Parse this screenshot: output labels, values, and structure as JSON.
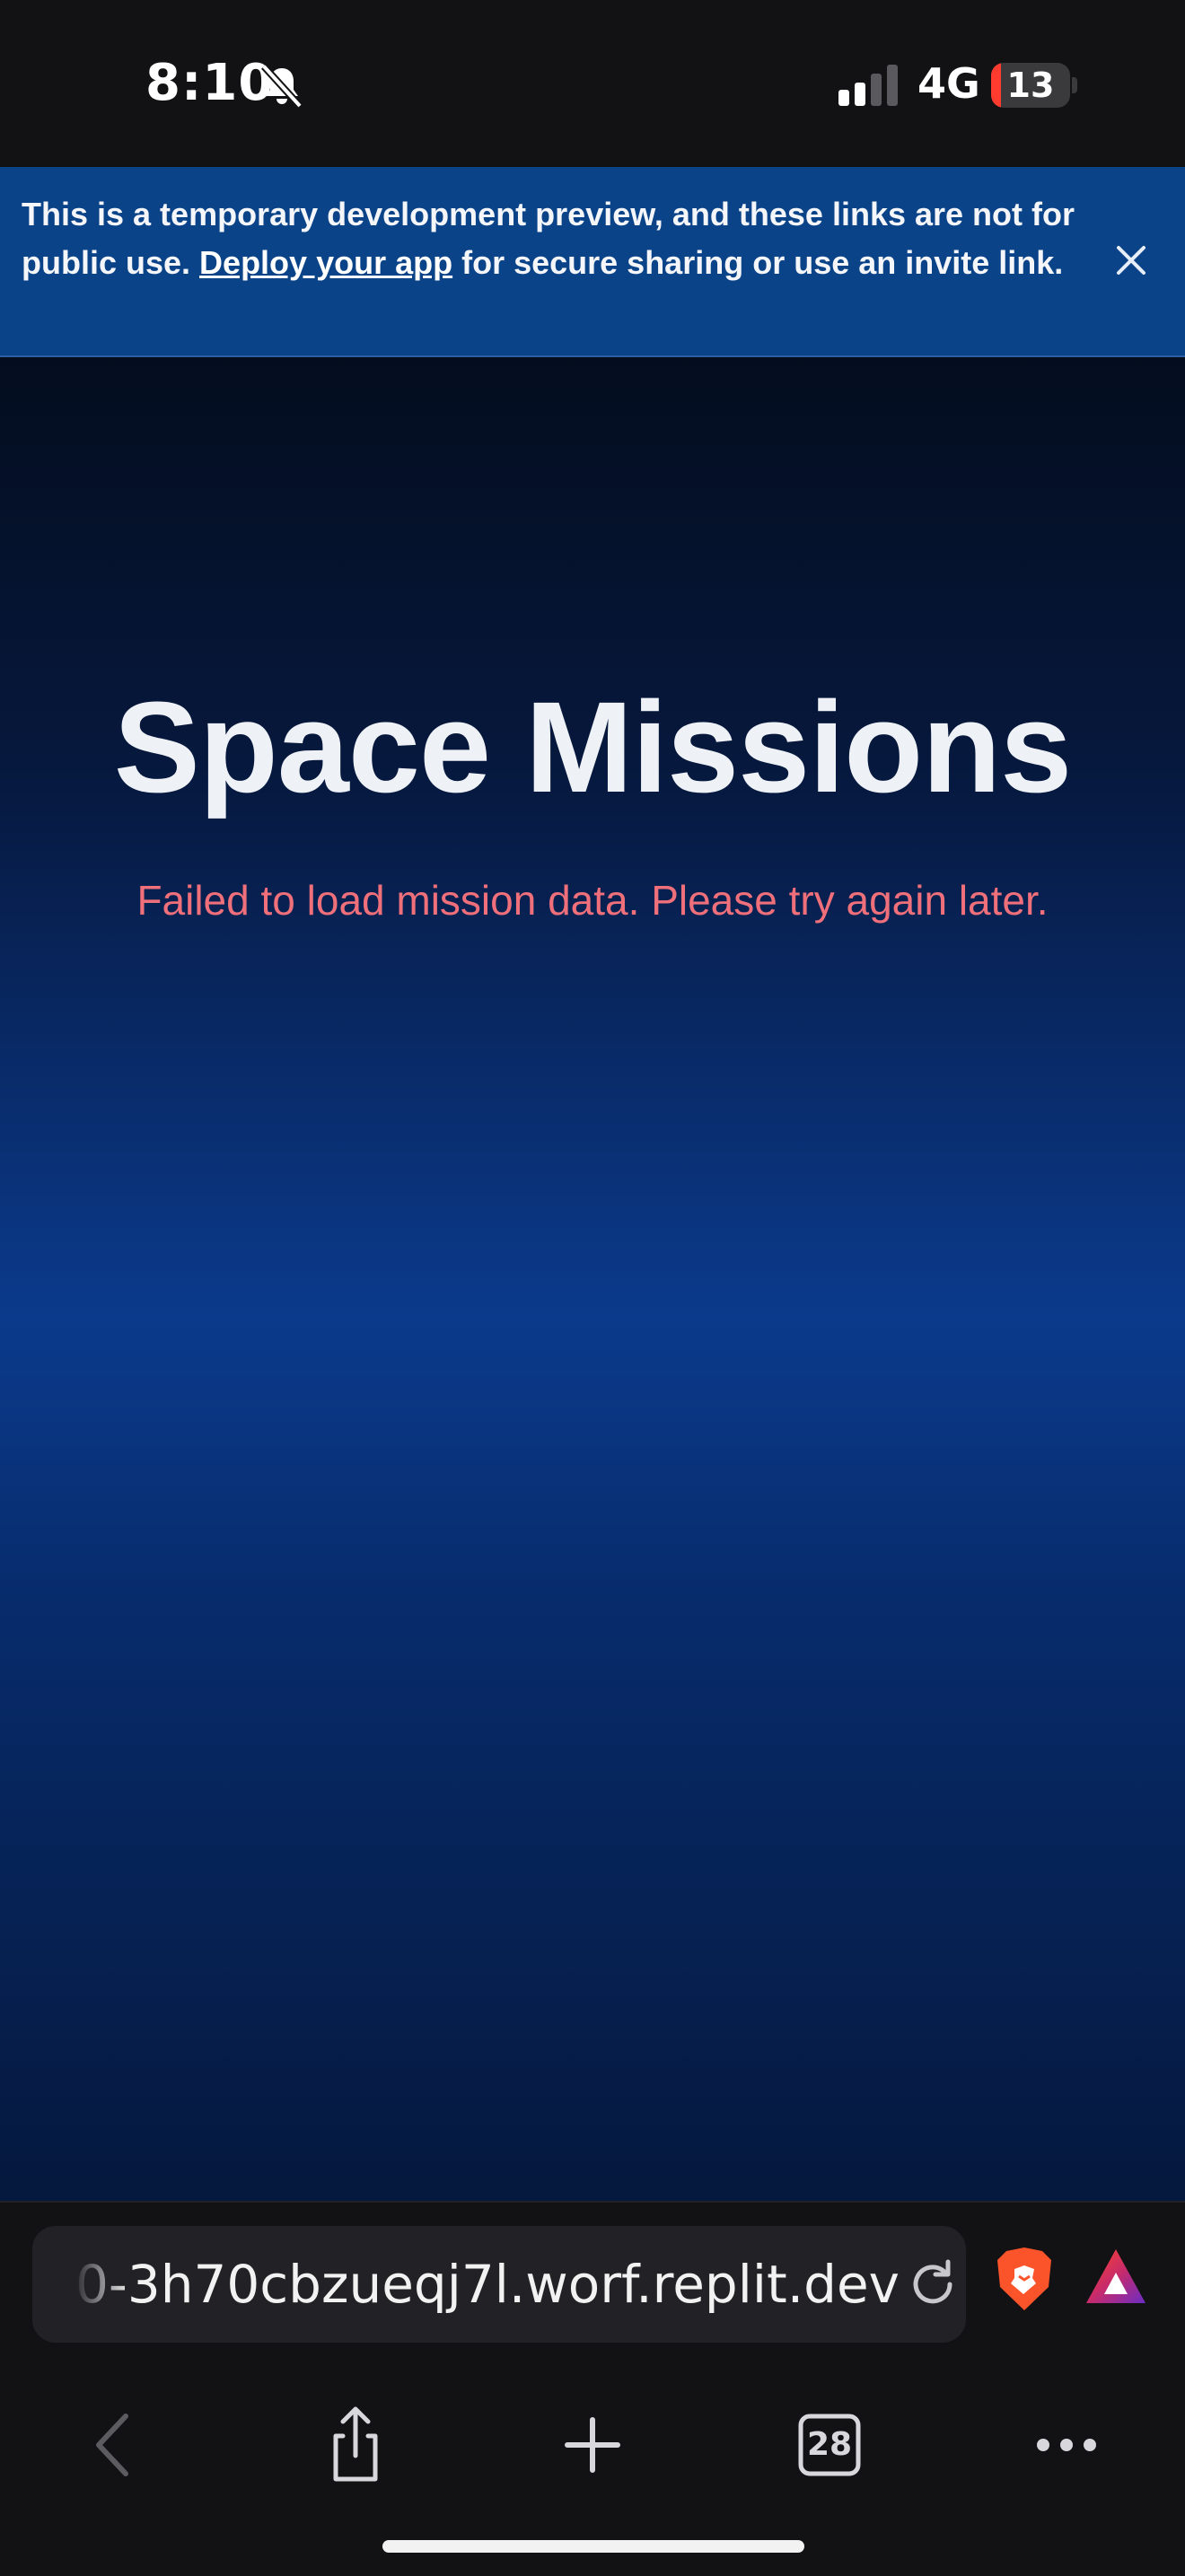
{
  "status_bar": {
    "time": "8:10",
    "network": "4G",
    "battery_level": "13",
    "battery_fraction": 0.13,
    "icons": [
      "bell-slash-icon",
      "cellular-signal-icon",
      "battery-icon"
    ]
  },
  "banner": {
    "text_before": "This is a temporary development preview, and these links are not for public use. ",
    "link_text": "Deploy your app",
    "text_after": " for secure sharing or use an invite link.",
    "close_icon": "close-icon",
    "background": "#0b4389"
  },
  "main": {
    "title": "Space Missions",
    "error": "Failed to load mission data. Please try again later.",
    "error_color": "#ef6f7a"
  },
  "browser": {
    "url": "0-3h70cbzueqj7l.worf.replit.dev",
    "tab_count": "28",
    "icons": [
      "reload-icon",
      "brave-shields-icon",
      "brave-rewards-icon",
      "back-icon",
      "share-icon",
      "new-tab-icon",
      "tabs-icon",
      "more-icon"
    ]
  }
}
